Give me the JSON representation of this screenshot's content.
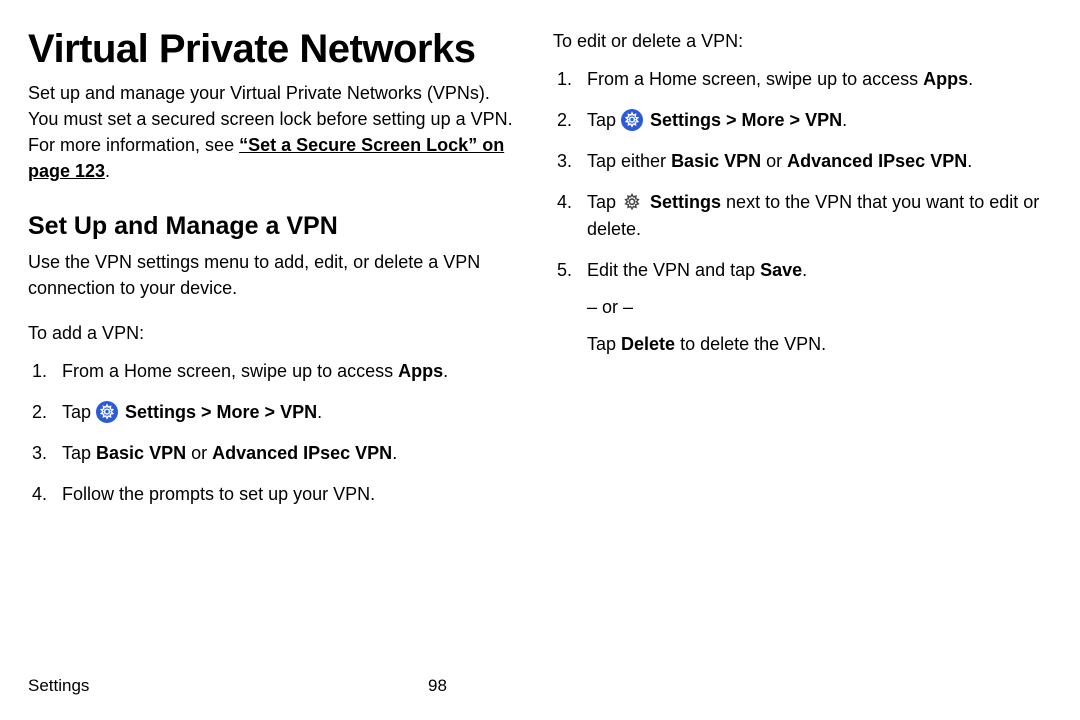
{
  "title": "Virtual Private Networks",
  "intro_a": "Set up and manage your Virtual Private Networks (VPNs). You must set a secured screen lock before setting up a VPN. For more information, see ",
  "intro_link": "“Set a Secure Screen Lock” on page 123",
  "intro_b": ".",
  "h2": "Set Up and Manage a VPN",
  "lead": "Use the VPN settings menu to add, edit, or delete a VPN connection to your device.",
  "add_label": "To add a VPN:",
  "edit_label": "To edit or delete a VPN:",
  "step_home_a": "From a Home screen, swipe up to access ",
  "step_home_b": "Apps",
  "step_home_c": ".",
  "tap": "Tap ",
  "settings_path": " Settings > More > VPN",
  "period": ".",
  "add3_a": "Tap ",
  "add3_b": "Basic VPN",
  "add3_c": " or ",
  "add3_d": "Advanced IPsec VPN",
  "add4": "Follow the prompts to set up your VPN.",
  "edit3_a": "Tap either ",
  "edit3_b": "Basic VPN",
  "edit3_c": " or ",
  "edit3_d": "Advanced IPsec VPN",
  "edit4_a": "Tap ",
  "edit4_b": " Settings",
  "edit4_c": " next to the VPN that you want to edit or delete.",
  "edit5_a": "Edit the VPN and tap ",
  "edit5_b": "Save",
  "edit5_or": "– or –",
  "edit5_del_a": "Tap ",
  "edit5_del_b": "Delete",
  "edit5_del_c": " to delete the VPN.",
  "footer_section": "Settings",
  "footer_page": "98"
}
